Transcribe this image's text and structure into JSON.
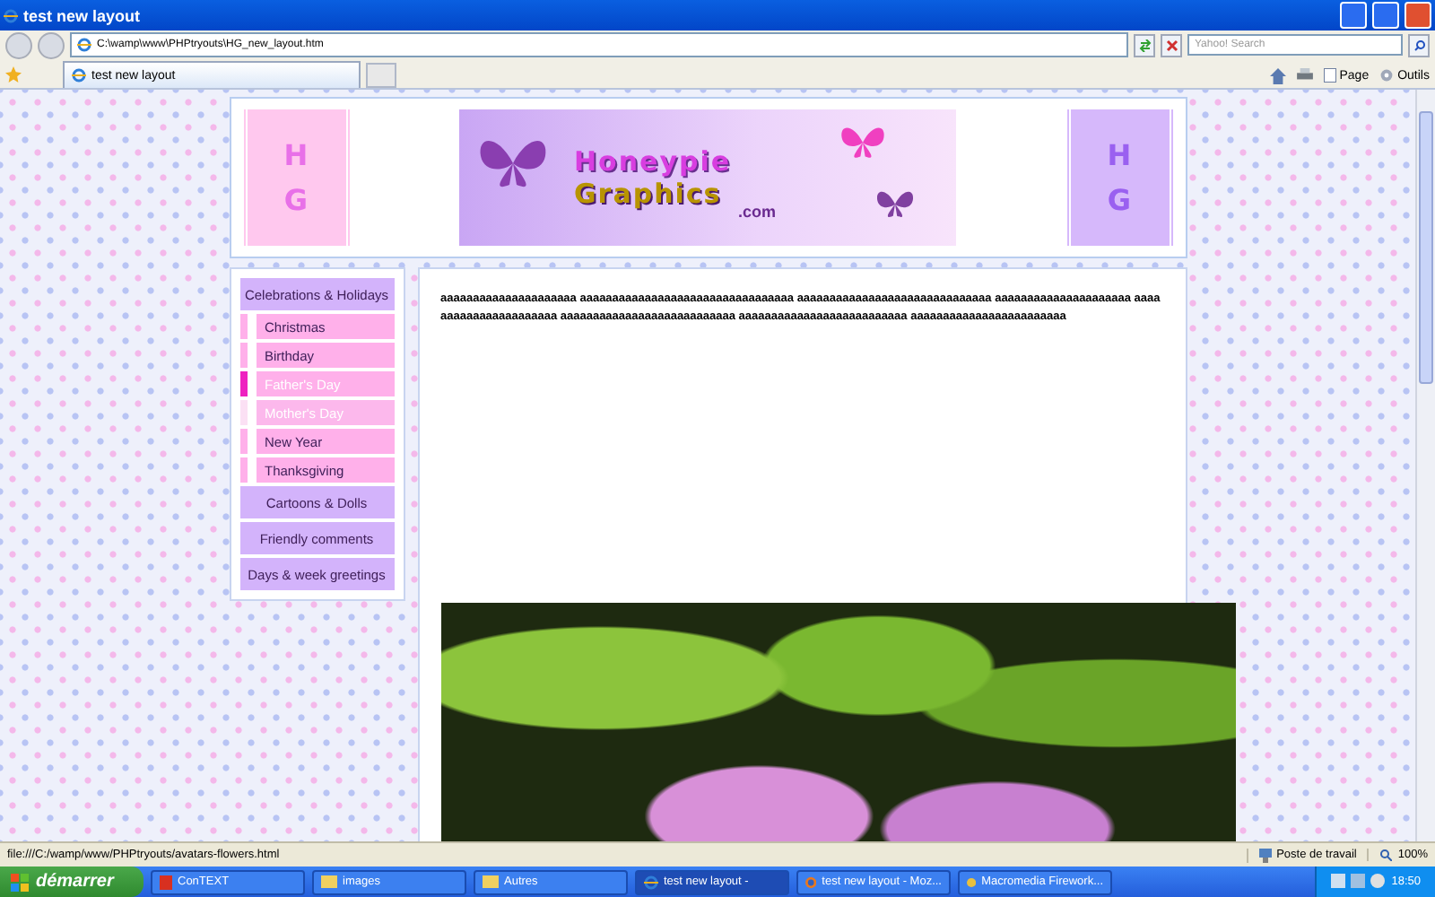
{
  "window": {
    "title": "test new layout"
  },
  "address_bar": {
    "url": "C:\\wamp\\www\\PHPtryouts\\HG_new_layout.htm",
    "search_placeholder": "Yahoo! Search"
  },
  "tabs": [
    {
      "label": "test new layout",
      "selected": true
    }
  ],
  "toolbar": {
    "page_label": "Page",
    "tools_label": "Outils"
  },
  "header": {
    "left_tile": [
      "H",
      "G"
    ],
    "logo_line_1": "Honeypie",
    "logo_line_2": "Graphics",
    "logo_suffix": ".com",
    "right_tile": [
      "H",
      "G"
    ]
  },
  "sidebar": {
    "items": [
      {
        "kind": "header",
        "label": "Celebrations & Holidays"
      },
      {
        "kind": "sub",
        "label": "Christmas",
        "selected": false,
        "visited": false
      },
      {
        "kind": "sub",
        "label": "Birthday",
        "selected": false,
        "visited": false
      },
      {
        "kind": "sub",
        "label": "Father's Day",
        "selected": true,
        "visited": false
      },
      {
        "kind": "sub",
        "label": "Mother's Day",
        "selected": false,
        "visited": true
      },
      {
        "kind": "sub",
        "label": "New Year",
        "selected": false,
        "visited": false
      },
      {
        "kind": "sub",
        "label": "Thanksgiving",
        "selected": false,
        "visited": false
      },
      {
        "kind": "header",
        "label": "Cartoons & Dolls"
      },
      {
        "kind": "header",
        "label": "Friendly comments"
      },
      {
        "kind": "header",
        "label": "Days & week greetings"
      }
    ]
  },
  "content": {
    "paragraph": "aaaaaaaaaaaaaaaaaaaaa aaaaaaaaaaaaaaaaaaaaaaaaaaaaaaaaa aaaaaaaaaaaaaaaaaaaaaaaaaaaaaa aaaaaaaaaaaaaaaaaaaaa aaaaaaaaaaaaaaaaaaaaaa aaaaaaaaaaaaaaaaaaaaaaaaaaa aaaaaaaaaaaaaaaaaaaaaaaaaa aaaaaaaaaaaaaaaaaaaaaaaa"
  },
  "status_bar": {
    "url": "file:///C:/wamp/www/PHPtryouts/avatars-flowers.html",
    "zone": "Poste de travail",
    "zoom": "100%"
  },
  "taskbar": {
    "start": "démarrer",
    "items": [
      {
        "label": "ConTEXT",
        "kind": "editor",
        "selected": false
      },
      {
        "label": "images",
        "kind": "folder",
        "selected": false
      },
      {
        "label": "Autres",
        "kind": "folder",
        "selected": false
      },
      {
        "label": "test new layout -",
        "kind": "ie",
        "selected": true
      },
      {
        "label": "test new layout - Moz...",
        "kind": "firefox",
        "selected": false
      },
      {
        "label": "Macromedia Firework...",
        "kind": "fireworks",
        "selected": false
      }
    ],
    "clock": "18:50"
  }
}
